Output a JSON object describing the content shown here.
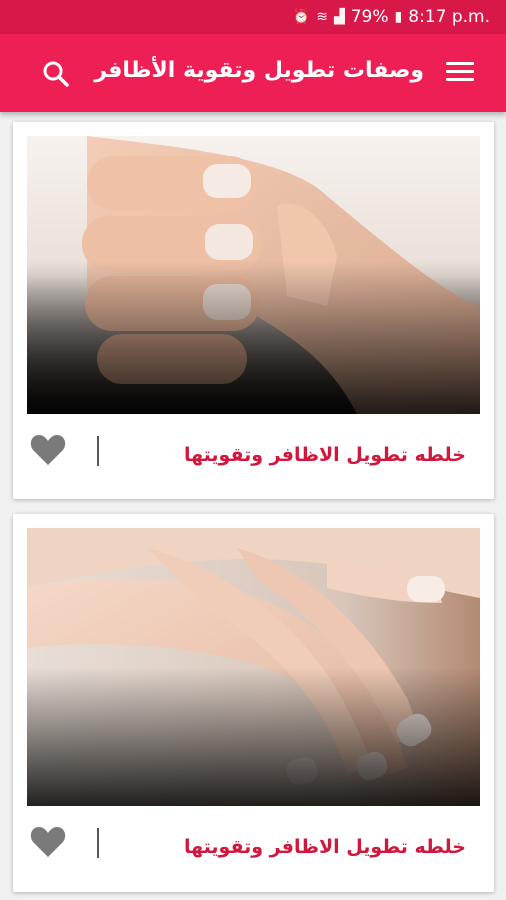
{
  "status_bar": {
    "battery": "79%",
    "time": "8:17 p.m.",
    "icons": [
      "alarm-icon",
      "wifi-icon",
      "signal-icon",
      "battery-icon"
    ]
  },
  "app_bar": {
    "title": "وصفات تطويل وتقوية الأظافر",
    "icons": [
      "menu-icon",
      "search-icon"
    ]
  },
  "cards": [
    {
      "caption": "خلطه تطويل الاظافر وتقويتها"
    },
    {
      "caption": "خلطه تطويل الاظافر وتقويتها"
    }
  ],
  "colors": {
    "primary": "#ee1f55",
    "status_bar": "#d9184a",
    "caption": "#d2173d"
  }
}
